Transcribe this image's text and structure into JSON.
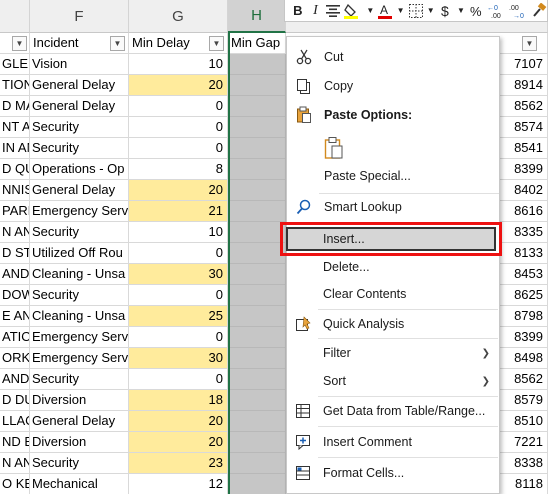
{
  "columns": [
    {
      "letter": "",
      "left": 0
    },
    {
      "letter": "F"
    },
    {
      "letter": "G"
    },
    {
      "letter": "H"
    }
  ],
  "header_row": {
    "e_partial": "n",
    "f": "Incident",
    "g": "Min Delay",
    "h": "Min Gap",
    "i_partial": "",
    "j_partial": ""
  },
  "rows": [
    {
      "e": " GLEN",
      "f": "Vision",
      "g": "10",
      "g_hl": false,
      "k": "7107"
    },
    {
      "e": "TION",
      "f": "General Delay",
      "g": "20",
      "g_hl": true,
      "k": "8914"
    },
    {
      "e": "D MA",
      "f": "General Delay",
      "g": "0",
      "g_hl": false,
      "k": "8562"
    },
    {
      "e": "NT AI",
      "f": "Security",
      "g": "0",
      "g_hl": false,
      "k": "8574"
    },
    {
      "e": "IN AN",
      "f": "Security",
      "g": "0",
      "g_hl": false,
      "k": "8541"
    },
    {
      "e": "D QU",
      "f": "Operations - Op",
      "g": "8",
      "g_hl": false,
      "k": "8399"
    },
    {
      "e": "NNIS",
      "f": "General Delay",
      "g": "20",
      "g_hl": true,
      "k": "8402"
    },
    {
      "e": "PARK",
      "f": "Emergency Serv",
      "g": "21",
      "g_hl": true,
      "k": "8616"
    },
    {
      "e": "N ANI",
      "f": "Security",
      "g": "10",
      "g_hl": false,
      "k": "8335"
    },
    {
      "e": "D ST",
      "f": "Utilized Off Rou",
      "g": "0",
      "g_hl": false,
      "k": "8133"
    },
    {
      "e": "AND",
      "f": "Cleaning - Unsa",
      "g": "30",
      "g_hl": true,
      "k": "8453"
    },
    {
      "e": "DOW",
      "f": "Security",
      "g": "0",
      "g_hl": false,
      "k": "8625"
    },
    {
      "e": "E ANI",
      "f": "Cleaning - Unsa",
      "g": "25",
      "g_hl": true,
      "k": "8798"
    },
    {
      "e": "ATIO",
      "f": "Emergency Serv",
      "g": "0",
      "g_hl": false,
      "k": "8399"
    },
    {
      "e": "ORKV",
      "f": "Emergency Serv",
      "g": "30",
      "g_hl": true,
      "k": "8498"
    },
    {
      "e": "AND",
      "f": "Security",
      "g": "0",
      "g_hl": false,
      "k": "8562"
    },
    {
      "e": "D DUI",
      "f": "Diversion",
      "g": "18",
      "g_hl": true,
      "k": "8579"
    },
    {
      "e": "LLAC",
      "f": "General Delay",
      "g": "20",
      "g_hl": true,
      "k": "8510"
    },
    {
      "e": "ND B",
      "f": "Diversion",
      "g": "20",
      "g_hl": true,
      "k": "7221"
    },
    {
      "e": "N ANI",
      "f": "Security",
      "g": "23",
      "g_hl": true,
      "k": "8338"
    },
    {
      "e": "O KEN",
      "f": "Mechanical",
      "g": "12",
      "g_hl": false,
      "k": "8118"
    }
  ],
  "mini_toolbar": {
    "bold": "B",
    "italic": "I"
  },
  "menu": {
    "cut": "Cut",
    "copy": "Copy",
    "paste_options": "Paste Options:",
    "paste_special": "Paste Special...",
    "smart_lookup": "Smart Lookup",
    "insert": "Insert...",
    "delete": "Delete...",
    "clear_contents": "Clear Contents",
    "quick_analysis": "Quick Analysis",
    "filter": "Filter",
    "sort": "Sort",
    "get_data": "Get Data from Table/Range...",
    "insert_comment": "Insert Comment",
    "format_cells": "Format Cells..."
  },
  "colors": {
    "highlight_fill": "#ffeb9c",
    "selected_column": "#c6c6c6",
    "excel_green": "#217346",
    "callout_red": "#ee1111"
  }
}
